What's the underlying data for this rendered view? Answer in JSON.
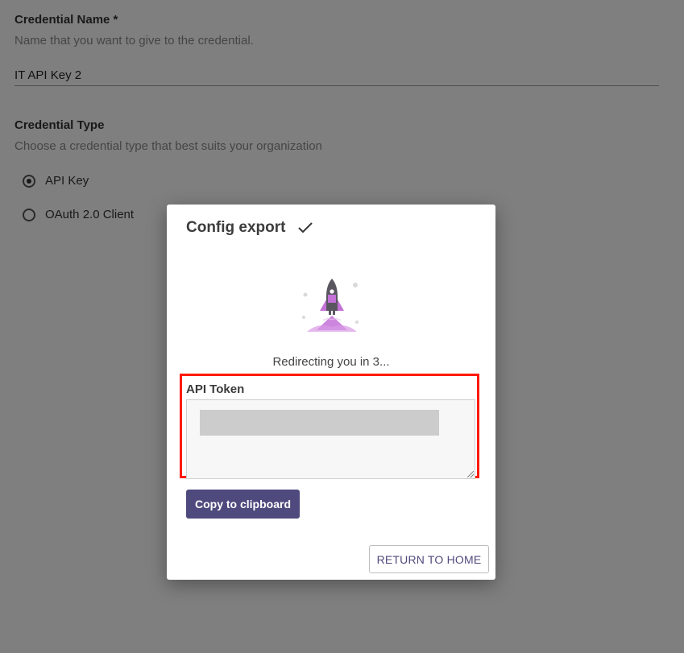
{
  "form": {
    "credential_name": {
      "label": "Credential Name *",
      "help": "Name that you want to give to the credential.",
      "value": "IT API Key 2"
    },
    "credential_type": {
      "label": "Credential Type",
      "help": "Choose a credential type that best suits your organization",
      "options": [
        {
          "label": "API Key",
          "selected": true
        },
        {
          "label": "OAuth 2.0 Client",
          "selected": false
        }
      ]
    }
  },
  "modal": {
    "title": "Config export",
    "title_icon": "check-icon",
    "illustration": "rocket-launch-illustration",
    "redirect_text": "Redirecting you in 3...",
    "token_label": "API Token",
    "token_value": "",
    "copy_button": "Copy to clipboard",
    "return_button": "RETURN TO HOME"
  },
  "colors": {
    "primary_button": "#4f4a7d",
    "highlight_border": "#ff1a00",
    "rocket_accent": "#c471d8",
    "overlay": "rgba(0,0,0,0.5)"
  }
}
